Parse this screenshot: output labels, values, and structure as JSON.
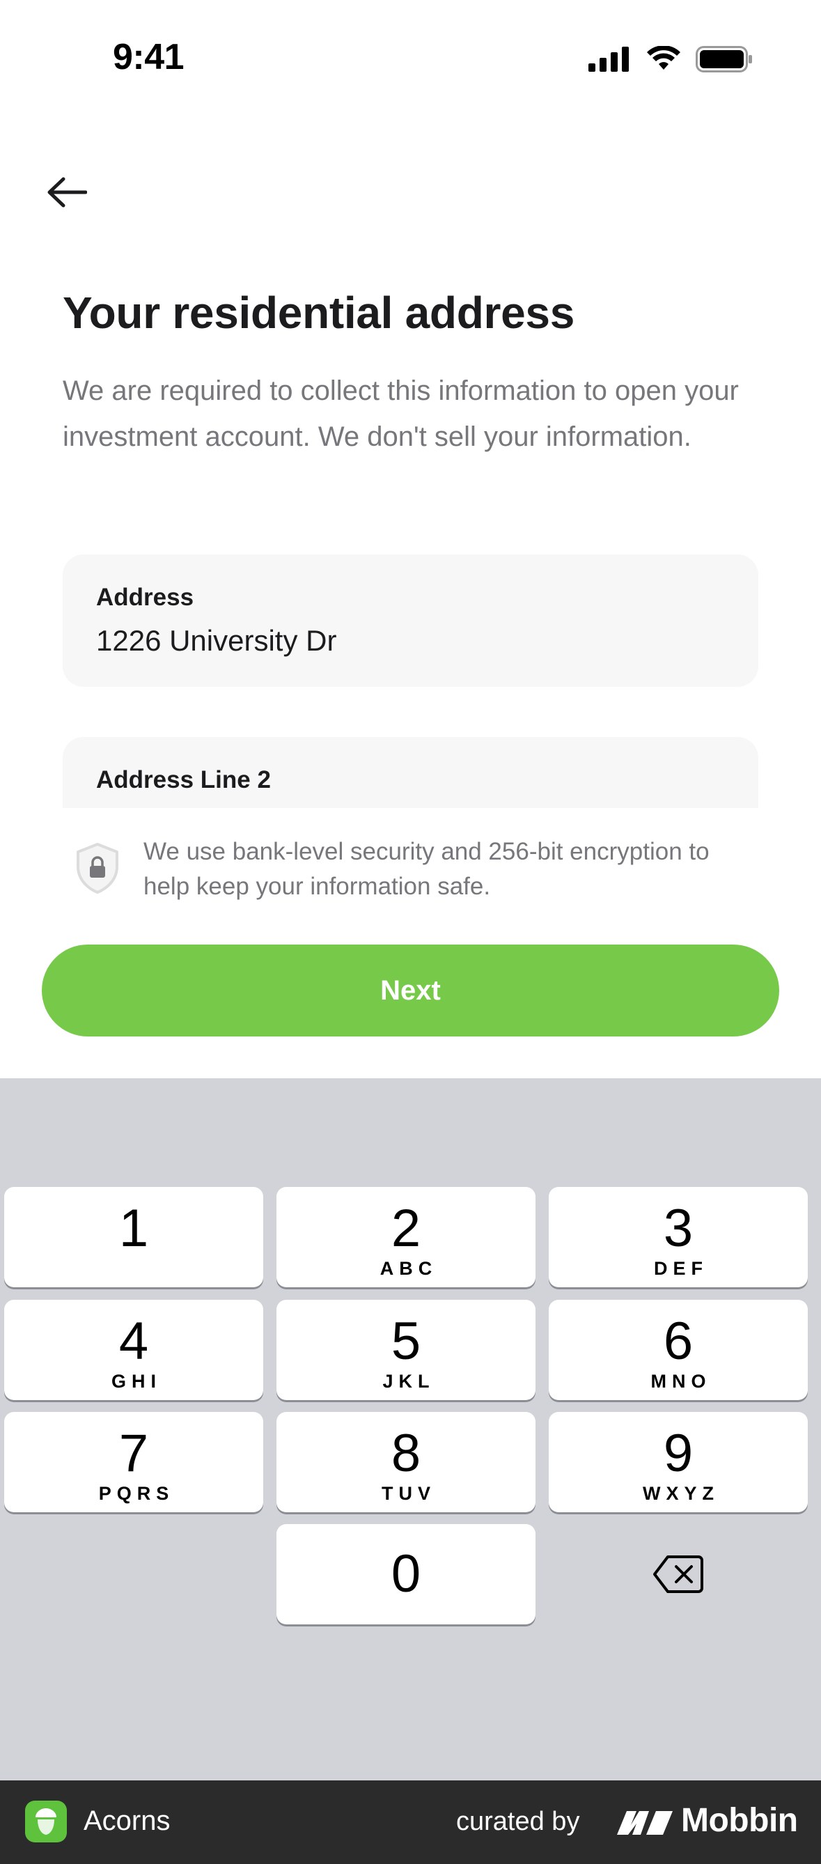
{
  "status_bar": {
    "time": "9:41",
    "icons": [
      "signal-icon",
      "wifi-icon",
      "battery-icon"
    ]
  },
  "header": {
    "back_icon": "arrow-left-icon"
  },
  "main": {
    "title": "Your residential address",
    "subtitle": "We are required to collect this information to open your investment account. We don't sell your information.",
    "fields": [
      {
        "label": "Address",
        "value": "1226 University Dr"
      },
      {
        "label": "Address Line 2",
        "value": ""
      }
    ],
    "security_note": "We use bank-level security and 256-bit encryption to help keep your information safe.",
    "next_label": "Next"
  },
  "keyboard": {
    "keys": [
      {
        "num": "1",
        "letters": ""
      },
      {
        "num": "2",
        "letters": "ABC"
      },
      {
        "num": "3",
        "letters": "DEF"
      },
      {
        "num": "4",
        "letters": "GHI"
      },
      {
        "num": "5",
        "letters": "JKL"
      },
      {
        "num": "6",
        "letters": "MNO"
      },
      {
        "num": "7",
        "letters": "PQRS"
      },
      {
        "num": "8",
        "letters": "TUV"
      },
      {
        "num": "9",
        "letters": "WXYZ"
      },
      {
        "num": "0",
        "letters": ""
      }
    ],
    "delete_icon": "backspace-icon"
  },
  "footer": {
    "app_name": "Acorns",
    "curated_by": "curated by",
    "brand": "Mobbin"
  },
  "colors": {
    "accent": "#77c94a",
    "keyboard_bg": "#d1d3d9",
    "field_bg": "#f7f7f7",
    "muted_text": "#76767b",
    "footer_bg": "#2b2b2b"
  }
}
